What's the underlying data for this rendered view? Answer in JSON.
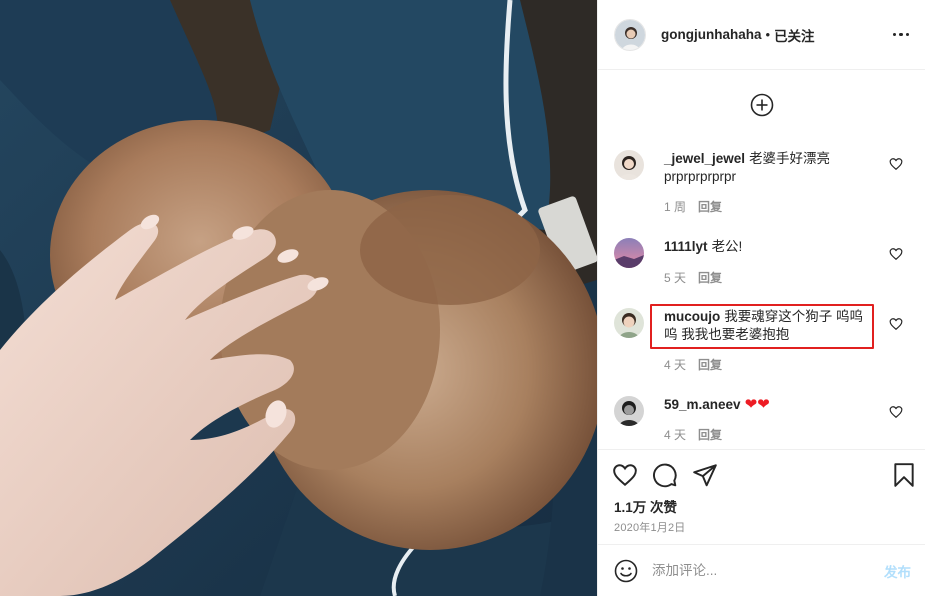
{
  "post": {
    "author": "gongjunhahaha",
    "separator": "•",
    "follow_status": "已关注"
  },
  "comments": [
    {
      "user": "_jewel_jewel",
      "text": "老婆手好漂亮prprprprprpr",
      "age": "1 周",
      "reply": "回复"
    },
    {
      "user": "1111lyt",
      "text": "老公!",
      "age": "5 天",
      "reply": "回复"
    },
    {
      "user": "mucoujo",
      "text": "我要魂穿这个狗子 呜呜呜 我我也要老婆抱抱",
      "age": "4 天",
      "reply": "回复"
    },
    {
      "user": "59_m.aneev",
      "text": "❤❤",
      "age": "4 天",
      "reply": "回复"
    }
  ],
  "stats": {
    "likes": "1.1万 次赞",
    "date": "2020年1月2日"
  },
  "add_comment": {
    "placeholder": "添加评论...",
    "post_label": "发布"
  },
  "icons": {
    "more": "more-dots-icon",
    "load_more": "plus-circle-icon",
    "like": "heart-icon",
    "comment": "comment-bubble-icon",
    "share": "paper-plane-icon",
    "save": "bookmark-icon",
    "emoji": "smiley-icon"
  },
  "colors": {
    "highlight_box": "#e1201f",
    "post_button_disabled": "#b2dffc",
    "meta_gray": "#8e8e8e"
  }
}
